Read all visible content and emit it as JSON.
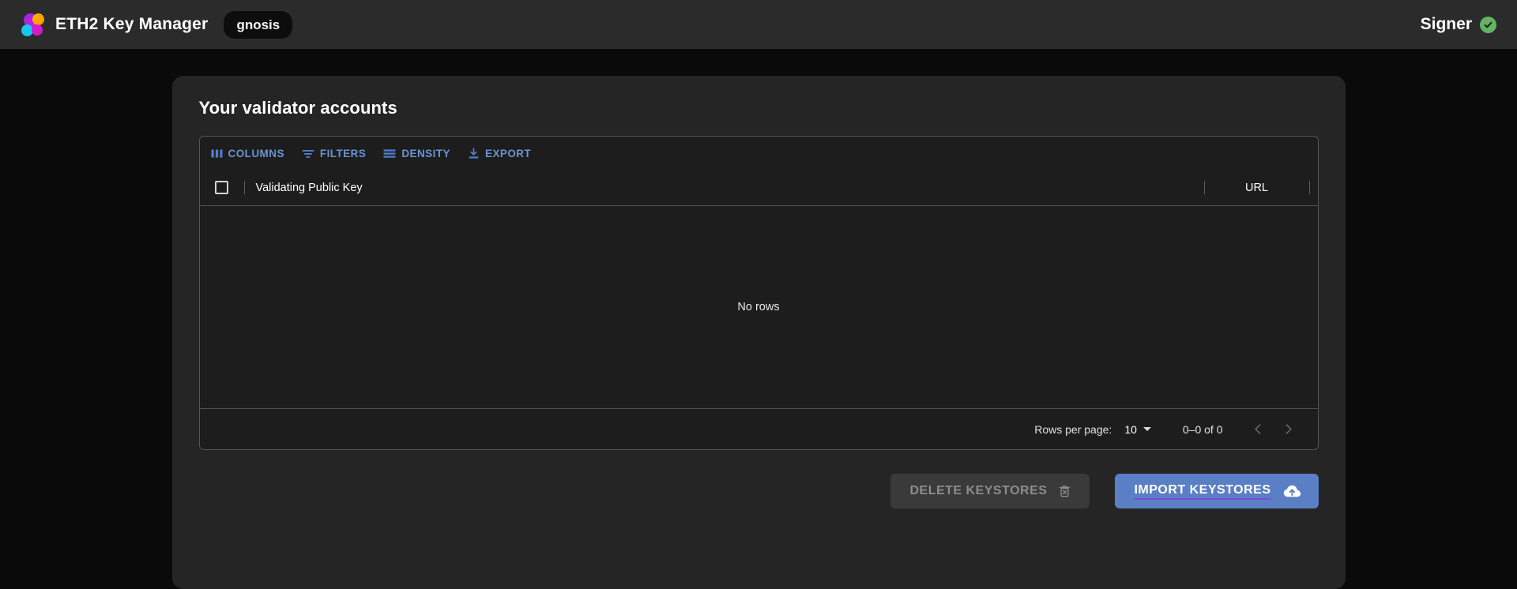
{
  "appbar": {
    "logo_icon": "eth2-keymanager-logo",
    "title": "ETH2 Key Manager",
    "network_badge": "gnosis",
    "signer_label": "Signer",
    "signer_status_icon": "check-circle-icon",
    "signer_status_color": "#61b561"
  },
  "card": {
    "title": "Your validator accounts"
  },
  "grid": {
    "toolbar": [
      {
        "label": "COLUMNS",
        "icon": "columns-icon"
      },
      {
        "label": "FILTERS",
        "icon": "filter-icon"
      },
      {
        "label": "DENSITY",
        "icon": "density-icon"
      },
      {
        "label": "EXPORT",
        "icon": "export-icon"
      }
    ],
    "toolbar_color": "#6a93d4",
    "columns": [
      {
        "field": "public_key",
        "label": "Validating Public Key"
      },
      {
        "field": "url",
        "label": "URL"
      }
    ],
    "select_all_checked": false,
    "rows": [],
    "empty_message": "No rows",
    "footer": {
      "rows_per_page_label": "Rows per page:",
      "rows_per_page_value": "10",
      "range_label": "0–0 of 0",
      "prev_icon": "chevron-left-icon",
      "next_icon": "chevron-right-icon",
      "prev_disabled": true,
      "next_disabled": true
    }
  },
  "actions": {
    "delete": {
      "label": "DELETE KEYSTORES",
      "icon": "trash-icon",
      "disabled": true
    },
    "import": {
      "label": "IMPORT KEYSTORES",
      "icon": "cloud-upload-icon",
      "color": "#5b7fc4",
      "disabled": false
    }
  }
}
